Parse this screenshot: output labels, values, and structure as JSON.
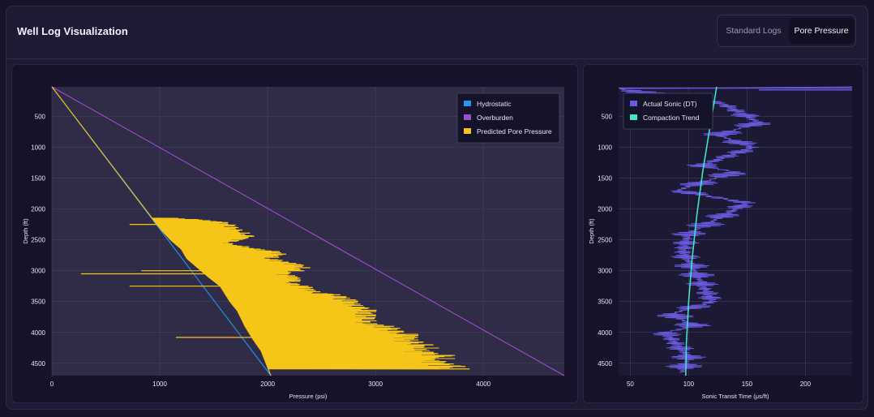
{
  "header": {
    "title": "Well Log Visualization",
    "tabs": [
      {
        "label": "Standard Logs",
        "active": false
      },
      {
        "label": "Pore Pressure",
        "active": true
      }
    ]
  },
  "colors": {
    "hydrostatic": "#2196f3",
    "overburden": "#9c4dcc",
    "pore_pressure": "#f5c518",
    "actual_sonic": "#6a5ae0",
    "compaction_trend": "#3ee6c4"
  },
  "chart_data": [
    {
      "type": "line",
      "title": "",
      "xlabel": "Pressure (psi)",
      "ylabel": "Depth (ft)",
      "xlim": [
        0,
        4750
      ],
      "ylim": [
        4700,
        20
      ],
      "x_ticks": [
        0,
        1000,
        2000,
        3000,
        4000
      ],
      "y_ticks": [
        500,
        1000,
        1500,
        2000,
        2500,
        3000,
        3500,
        4000,
        4500
      ],
      "grid": true,
      "legend_position": "top-right",
      "series": [
        {
          "name": "Hydrostatic",
          "kind": "line",
          "x": [
            0,
            2030
          ],
          "y": [
            20,
            4700
          ]
        },
        {
          "name": "Overburden",
          "kind": "line",
          "x": [
            0,
            4750
          ],
          "y": [
            20,
            4700
          ]
        },
        {
          "name": "Predicted Pore Pressure",
          "kind": "line",
          "x": [
            0,
            930,
            950,
            1020,
            1100,
            1200,
            1250,
            1350,
            1450,
            1560,
            1650,
            1720,
            1790,
            1860,
            1940,
            2030
          ],
          "y": [
            20,
            2150,
            2200,
            2350,
            2500,
            2650,
            2800,
            2950,
            3100,
            3250,
            3500,
            3650,
            3900,
            4100,
            4300,
            4700
          ],
          "excursions": [
            {
              "depth": 2150,
              "value": 1200
            },
            {
              "depth": 2200,
              "value": 1600
            },
            {
              "depth": 2250,
              "value": 1700
            },
            {
              "depth": 2300,
              "value": 1750
            },
            {
              "depth": 2350,
              "value": 1780
            },
            {
              "depth": 2400,
              "value": 1850
            },
            {
              "depth": 2450,
              "value": 1900
            },
            {
              "depth": 2500,
              "value": 1780
            },
            {
              "depth": 2550,
              "value": 1650
            },
            {
              "depth": 2600,
              "value": 1800
            },
            {
              "depth": 2650,
              "value": 1950
            },
            {
              "depth": 2700,
              "value": 2170
            },
            {
              "depth": 2750,
              "value": 2200
            },
            {
              "depth": 2800,
              "value": 2050
            },
            {
              "depth": 2850,
              "value": 2200
            },
            {
              "depth": 2900,
              "value": 2350
            },
            {
              "depth": 2950,
              "value": 2400
            },
            {
              "depth": 3000,
              "value": 2350
            },
            {
              "depth": 3050,
              "value": 2200
            },
            {
              "depth": 3100,
              "value": 2300
            },
            {
              "depth": 3150,
              "value": 2350
            },
            {
              "depth": 3200,
              "value": 2250
            },
            {
              "depth": 3250,
              "value": 2400
            },
            {
              "depth": 3300,
              "value": 2450
            },
            {
              "depth": 3350,
              "value": 2500
            },
            {
              "depth": 3400,
              "value": 2750
            },
            {
              "depth": 3450,
              "value": 2800
            },
            {
              "depth": 3500,
              "value": 2850
            },
            {
              "depth": 3550,
              "value": 2900
            },
            {
              "depth": 3600,
              "value": 2950
            },
            {
              "depth": 3650,
              "value": 3050
            },
            {
              "depth": 3700,
              "value": 3000
            },
            {
              "depth": 3750,
              "value": 3020
            },
            {
              "depth": 3800,
              "value": 3050
            },
            {
              "depth": 3850,
              "value": 2980
            },
            {
              "depth": 3900,
              "value": 3200
            },
            {
              "depth": 3950,
              "value": 3250
            },
            {
              "depth": 4000,
              "value": 3300
            },
            {
              "depth": 4050,
              "value": 3480
            },
            {
              "depth": 4100,
              "value": 3400
            },
            {
              "depth": 4150,
              "value": 3450
            },
            {
              "depth": 4200,
              "value": 3550
            },
            {
              "depth": 4250,
              "value": 3600
            },
            {
              "depth": 4300,
              "value": 3500
            },
            {
              "depth": 4350,
              "value": 3700
            },
            {
              "depth": 4400,
              "value": 3800
            },
            {
              "depth": 4450,
              "value": 3650
            },
            {
              "depth": 4500,
              "value": 3750
            },
            {
              "depth": 4550,
              "value": 3850
            },
            {
              "depth": 4600,
              "value": 3880
            }
          ],
          "low_spikes": [
            {
              "depth": 2250,
              "value": 720
            },
            {
              "depth": 3050,
              "value": 270
            },
            {
              "depth": 3250,
              "value": 720
            },
            {
              "depth": 3000,
              "value": 830
            },
            {
              "depth": 4080,
              "value": 1150
            }
          ]
        }
      ]
    },
    {
      "type": "line",
      "title": "",
      "xlabel": "Sonic Transit Time (μs/ft)",
      "ylabel": "Depth (ft)",
      "xlim": [
        40,
        240
      ],
      "ylim": [
        4700,
        20
      ],
      "x_ticks": [
        50,
        100,
        150,
        200
      ],
      "y_ticks": [
        500,
        1000,
        1500,
        2000,
        2500,
        3000,
        3500,
        4000,
        4500
      ],
      "grid": true,
      "legend_position": "top-left",
      "series": [
        {
          "name": "Actual Sonic (DT)",
          "kind": "line",
          "x": [
            240,
            40,
            130,
            160,
            125,
            155,
            110,
            140,
            90,
            150,
            120,
            100,
            95,
            105,
            120,
            85,
            105,
            80,
            100,
            95
          ],
          "y": [
            20,
            50,
            300,
            600,
            800,
            1000,
            1300,
            1400,
            1700,
            1900,
            2200,
            2400,
            2700,
            3000,
            3500,
            3700,
            3900,
            4000,
            4400,
            4600
          ]
        },
        {
          "name": "Compaction Trend",
          "kind": "line",
          "x": [
            124,
            118,
            112,
            107,
            103,
            100,
            98,
            97.5
          ],
          "y": [
            20,
            700,
            1400,
            2100,
            2800,
            3500,
            4200,
            4700
          ]
        }
      ]
    }
  ]
}
